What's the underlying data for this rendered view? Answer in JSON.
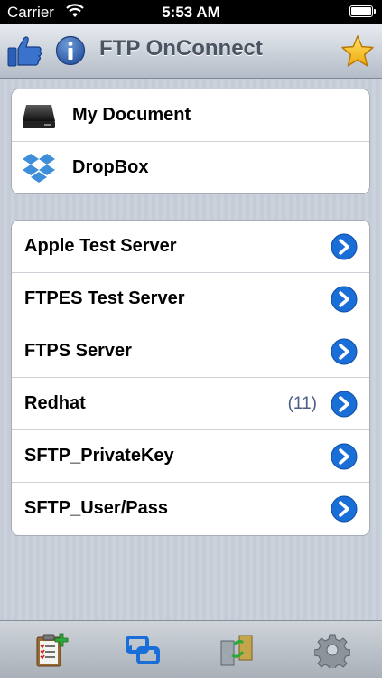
{
  "status": {
    "carrier": "Carrier",
    "time": "5:53 AM"
  },
  "nav": {
    "title": "FTP OnConnect",
    "icons": [
      "thumbs-up-icon",
      "info-icon",
      "star-icon"
    ]
  },
  "local": [
    {
      "label": "My Document",
      "icon": "hard-drive-icon"
    },
    {
      "label": "DropBox",
      "icon": "dropbox-icon"
    }
  ],
  "servers": [
    {
      "label": "Apple Test Server",
      "count": ""
    },
    {
      "label": "FTPES Test Server",
      "count": ""
    },
    {
      "label": "FTPS Server",
      "count": ""
    },
    {
      "label": "Redhat",
      "count": "(11)"
    },
    {
      "label": "SFTP_PrivateKey",
      "count": ""
    },
    {
      "label": "SFTP_User/Pass",
      "count": ""
    }
  ],
  "tabs": [
    "clipboard-add-icon",
    "transfer-icon",
    "servers-sync-icon",
    "gear-icon"
  ],
  "colors": {
    "accent_blue": "#1a6ed8",
    "star": "#f6c21a"
  }
}
